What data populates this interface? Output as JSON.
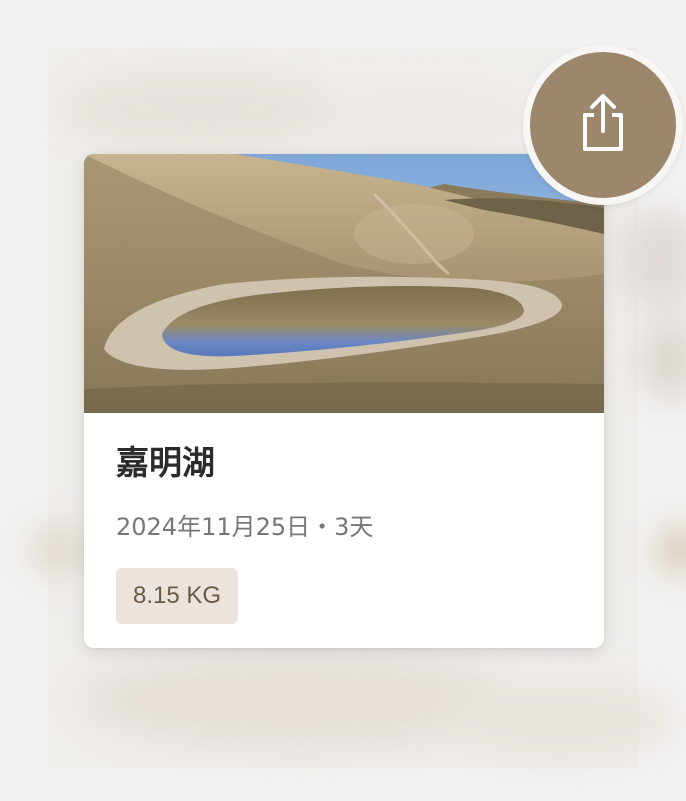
{
  "card": {
    "title": "嘉明湖",
    "meta": "2024年11月25日・3天",
    "weight": "8.15 KG"
  },
  "share": {
    "icon": "share-icon"
  },
  "colors": {
    "accent": "#9c876d",
    "badge_bg": "#ebe3dc",
    "badge_text": "#6b5a4a"
  }
}
